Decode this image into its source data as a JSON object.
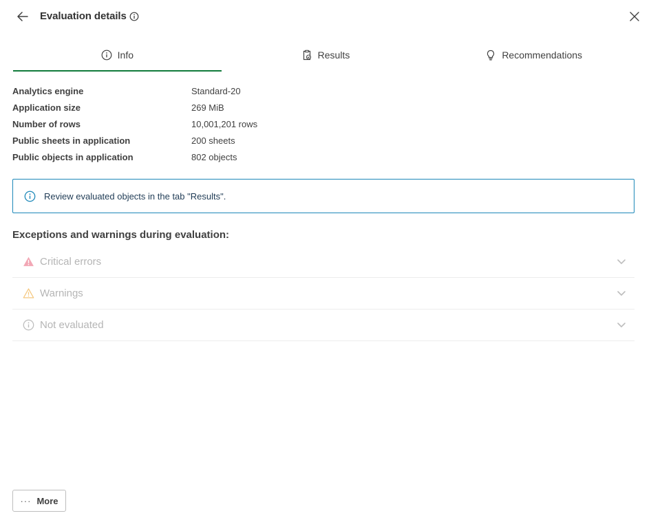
{
  "header": {
    "title": "Evaluation details",
    "back_icon": "arrow-left-icon",
    "info_icon": "info-icon",
    "close_icon": "close-icon"
  },
  "tabs": [
    {
      "label": "Info",
      "icon": "info-icon",
      "active": true
    },
    {
      "label": "Results",
      "icon": "clipboard-check-icon",
      "active": false
    },
    {
      "label": "Recommendations",
      "icon": "lightbulb-icon",
      "active": false
    }
  ],
  "info": {
    "rows": [
      {
        "label": "Analytics engine",
        "value": "Standard-20"
      },
      {
        "label": "Application size",
        "value": "269 MiB"
      },
      {
        "label": "Number of rows",
        "value": "10,001,201 rows"
      },
      {
        "label": "Public sheets in application",
        "value": "200 sheets"
      },
      {
        "label": "Public objects in application",
        "value": "802 objects"
      }
    ]
  },
  "banner": {
    "text": "Review evaluated objects in the tab \"Results\".",
    "icon": "info-icon",
    "border_color": "#1b87b8"
  },
  "exceptions": {
    "title": "Exceptions and warnings during evaluation:",
    "items": [
      {
        "label": "Critical errors",
        "icon": "warning-filled-icon",
        "color": "#f2a7b5"
      },
      {
        "label": "Warnings",
        "icon": "warning-outline-icon",
        "color": "#f5c77e"
      },
      {
        "label": "Not evaluated",
        "icon": "info-icon",
        "color": "#bdbdbd"
      }
    ]
  },
  "footer": {
    "more_label": "More",
    "more_icon": "ellipsis-icon"
  },
  "colors": {
    "accent": "#0f7a3a"
  }
}
